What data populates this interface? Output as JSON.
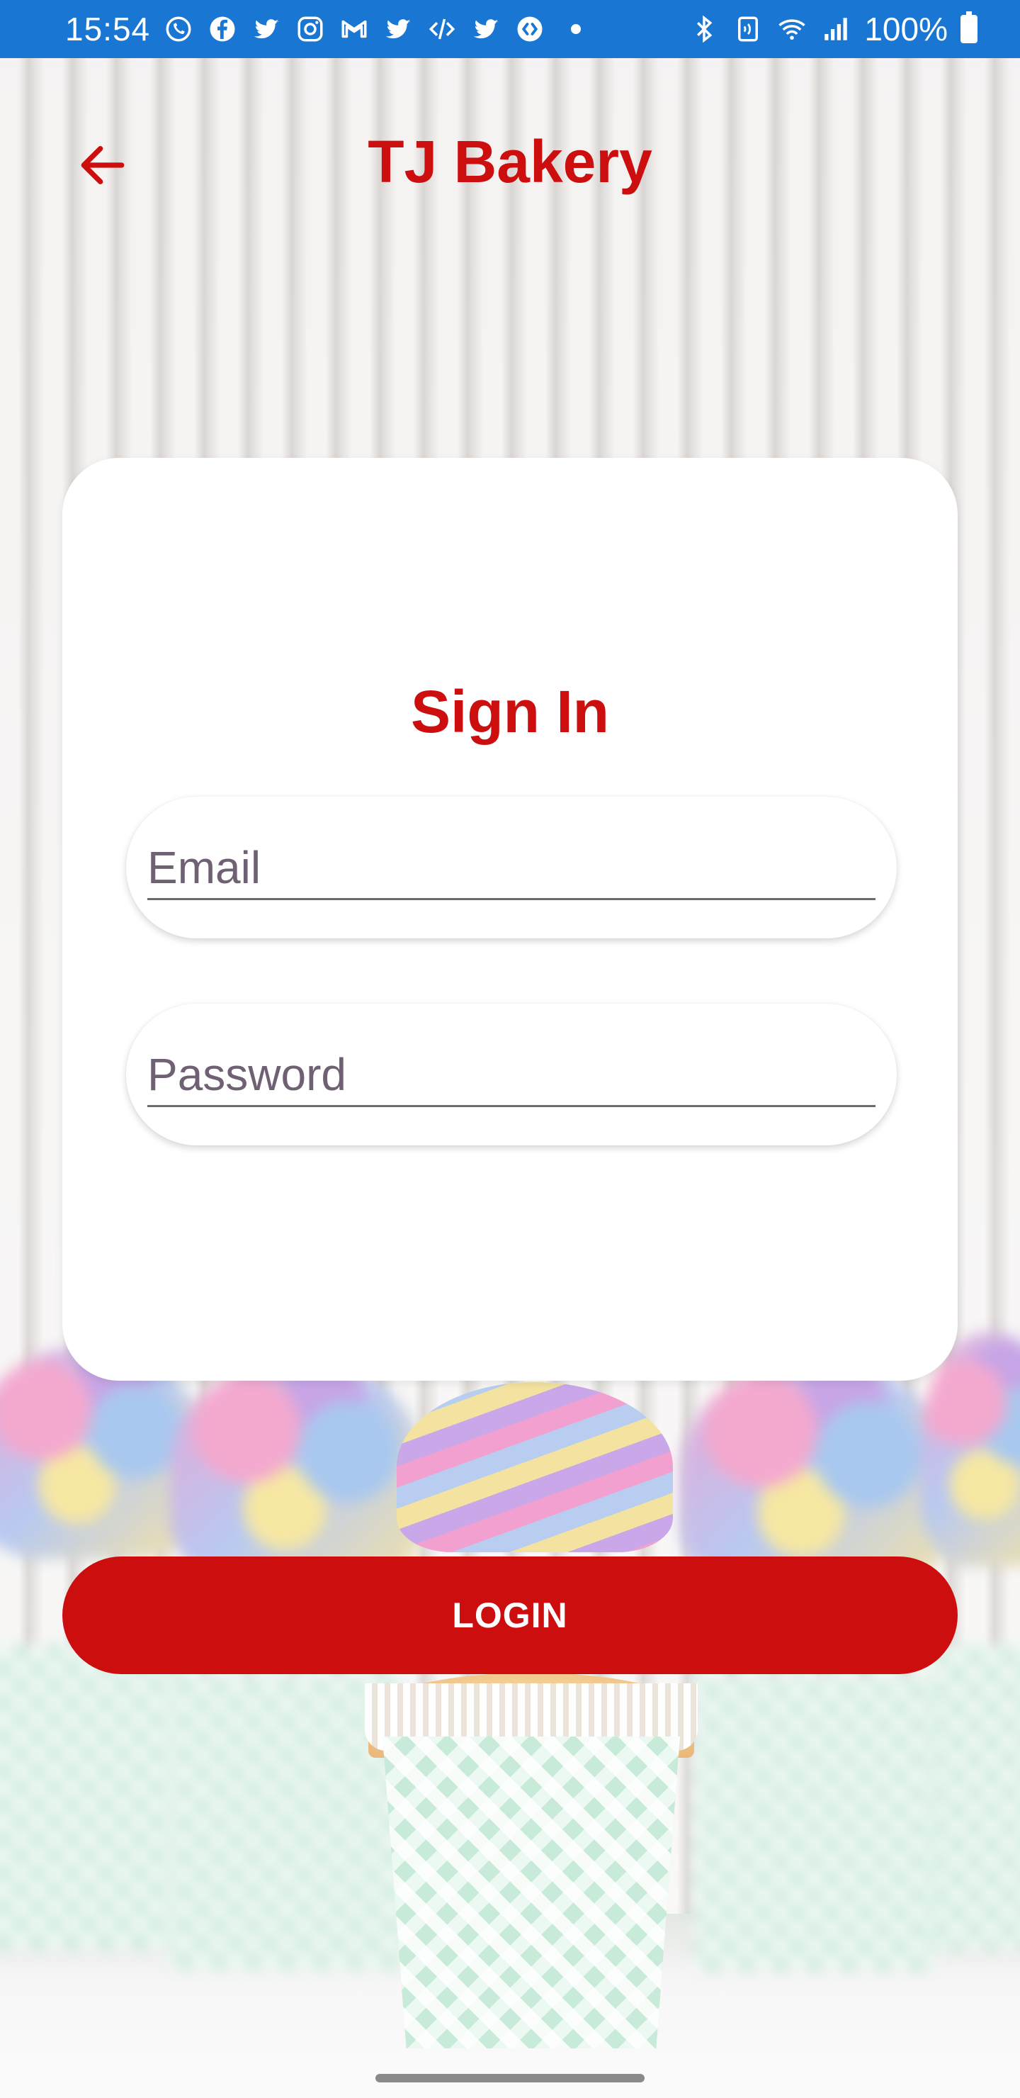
{
  "status_bar": {
    "time": "15:54",
    "battery_text": "100%",
    "left_icons": [
      "whatsapp-icon",
      "facebook-icon",
      "twitter-icon",
      "instagram-icon",
      "gmail-icon",
      "twitter-icon",
      "code-icon",
      "twitter-icon",
      "shazam-icon"
    ],
    "right_icons": [
      "bluetooth-icon",
      "nfc-icon",
      "wifi-icon",
      "signal-icon",
      "battery-icon"
    ],
    "background_color": "#1976d2"
  },
  "header": {
    "back_icon": "back-arrow-icon",
    "title": "TJ Bakery"
  },
  "form": {
    "title": "Sign In",
    "email_placeholder": "Email",
    "password_placeholder": "Password",
    "login_label": "LOGIN"
  },
  "colors": {
    "accent": "#cc0e0e",
    "card": "#ffffff"
  }
}
